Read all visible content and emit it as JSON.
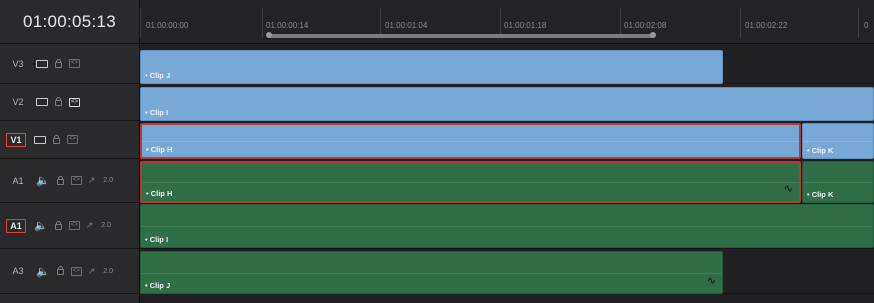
{
  "timecode": "01:00:05:13",
  "ruler": {
    "labels": [
      "01:00:00:00",
      "01:00:00:14",
      "01:00:01:04",
      "01:00:01:18",
      "01:00:02:08",
      "01:00:02:22",
      "0"
    ]
  },
  "tracks": [
    {
      "name": "V3",
      "type": "video",
      "active": false,
      "auto_on": false
    },
    {
      "name": "V2",
      "type": "video",
      "active": false,
      "auto_on": true
    },
    {
      "name": "V1",
      "type": "video",
      "active": true,
      "auto_on": false
    },
    {
      "name": "A1",
      "type": "audio",
      "active": false,
      "channels": "2.0"
    },
    {
      "name": "A1",
      "type": "audio",
      "active": true,
      "channels": "2.0"
    },
    {
      "name": "A3",
      "type": "audio",
      "active": false,
      "channels": "2.0"
    }
  ],
  "clips": {
    "v3_clip": "• Clip J",
    "v2_clip": "• Clip I",
    "v1_clip_h": "• Clip H",
    "v1_clip_k": "• Clip K",
    "a1_clip_h": "• Clip H",
    "a1_clip_k": "• Clip K",
    "a2_clip_i": "• Clip I",
    "a3_clip_j": "• Clip J"
  },
  "colors": {
    "video_clip": "#78a8d6",
    "audio_clip": "#2f6e47",
    "selection": "#b63a33",
    "active_track_border": "#d9413a"
  },
  "icons": [
    "monitor-icon",
    "lock-icon",
    "auto-select-icon",
    "speaker-icon",
    "curve-icon"
  ]
}
